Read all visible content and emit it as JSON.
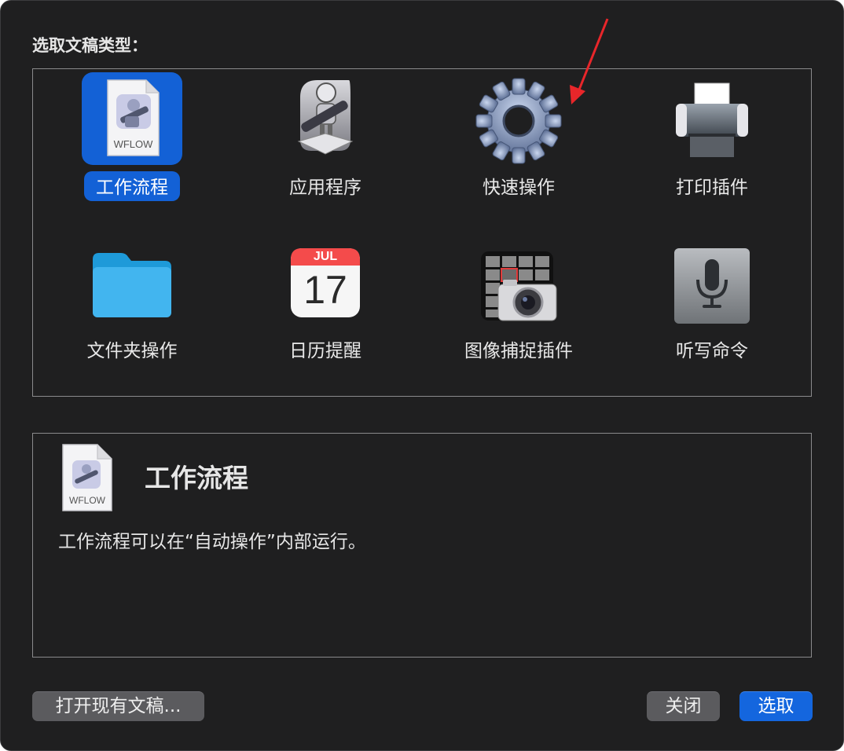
{
  "dialog": {
    "heading": "选取文稿类型：",
    "document_types": [
      {
        "label": "工作流程",
        "icon": "workflow-document-icon",
        "selected": true
      },
      {
        "label": "应用程序",
        "icon": "automator-robot-icon",
        "selected": false
      },
      {
        "label": "快速操作",
        "icon": "gear-icon",
        "selected": false
      },
      {
        "label": "打印插件",
        "icon": "printer-icon",
        "selected": false
      },
      {
        "label": "文件夹操作",
        "icon": "folder-icon",
        "selected": false
      },
      {
        "label": "日历提醒",
        "icon": "calendar-icon",
        "selected": false
      },
      {
        "label": "图像捕捉插件",
        "icon": "image-capture-icon",
        "selected": false
      },
      {
        "label": "听写命令",
        "icon": "microphone-icon",
        "selected": false
      }
    ],
    "calendar_month": "JUL",
    "calendar_day": "17",
    "workflow_file_tag": "WFLOW",
    "description": {
      "title": "工作流程",
      "text": "工作流程可以在“自动操作”内部运行。",
      "file_tag": "WFLOW"
    },
    "buttons": {
      "open_existing": "打开现有文稿...",
      "close": "关闭",
      "choose": "选取"
    }
  },
  "colors": {
    "background": "#1f1f20",
    "accent": "#1361d6",
    "arrow": "#e8262a"
  }
}
